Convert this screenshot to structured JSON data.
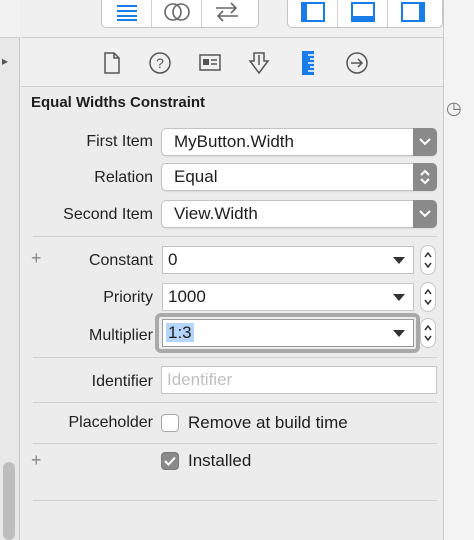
{
  "inspector": {
    "section_title": "Equal Widths Constraint",
    "first_item": {
      "label": "First Item",
      "value": "MyButton.Width"
    },
    "relation": {
      "label": "Relation",
      "value": "Equal"
    },
    "second_item": {
      "label": "Second Item",
      "value": "View.Width"
    },
    "constant": {
      "label": "Constant",
      "value": "0"
    },
    "priority": {
      "label": "Priority",
      "value": "1000"
    },
    "multiplier": {
      "label": "Multiplier",
      "value": "1:3"
    },
    "identifier": {
      "label": "Identifier",
      "placeholder": "Identifier",
      "value": ""
    },
    "placeholder": {
      "label": "Placeholder",
      "checkbox_label": "Remove at build time",
      "checked": false
    },
    "installed": {
      "label": "Installed",
      "checked": true
    }
  },
  "icons": {
    "toolbar": [
      "align-left-icon",
      "link-circles-icon",
      "swap-arrows-icon",
      "layout-left-icon",
      "layout-bottom-icon",
      "layout-right-icon"
    ],
    "inspector_tabs": [
      "file-icon",
      "help-icon",
      "identity-icon",
      "attributes-icon",
      "size-ruler-icon",
      "connections-arrow-icon"
    ]
  },
  "colors": {
    "accent": "#1a7ce8",
    "selection": "#b5d5fd",
    "checkbox_checked": "#8a8a8a"
  }
}
